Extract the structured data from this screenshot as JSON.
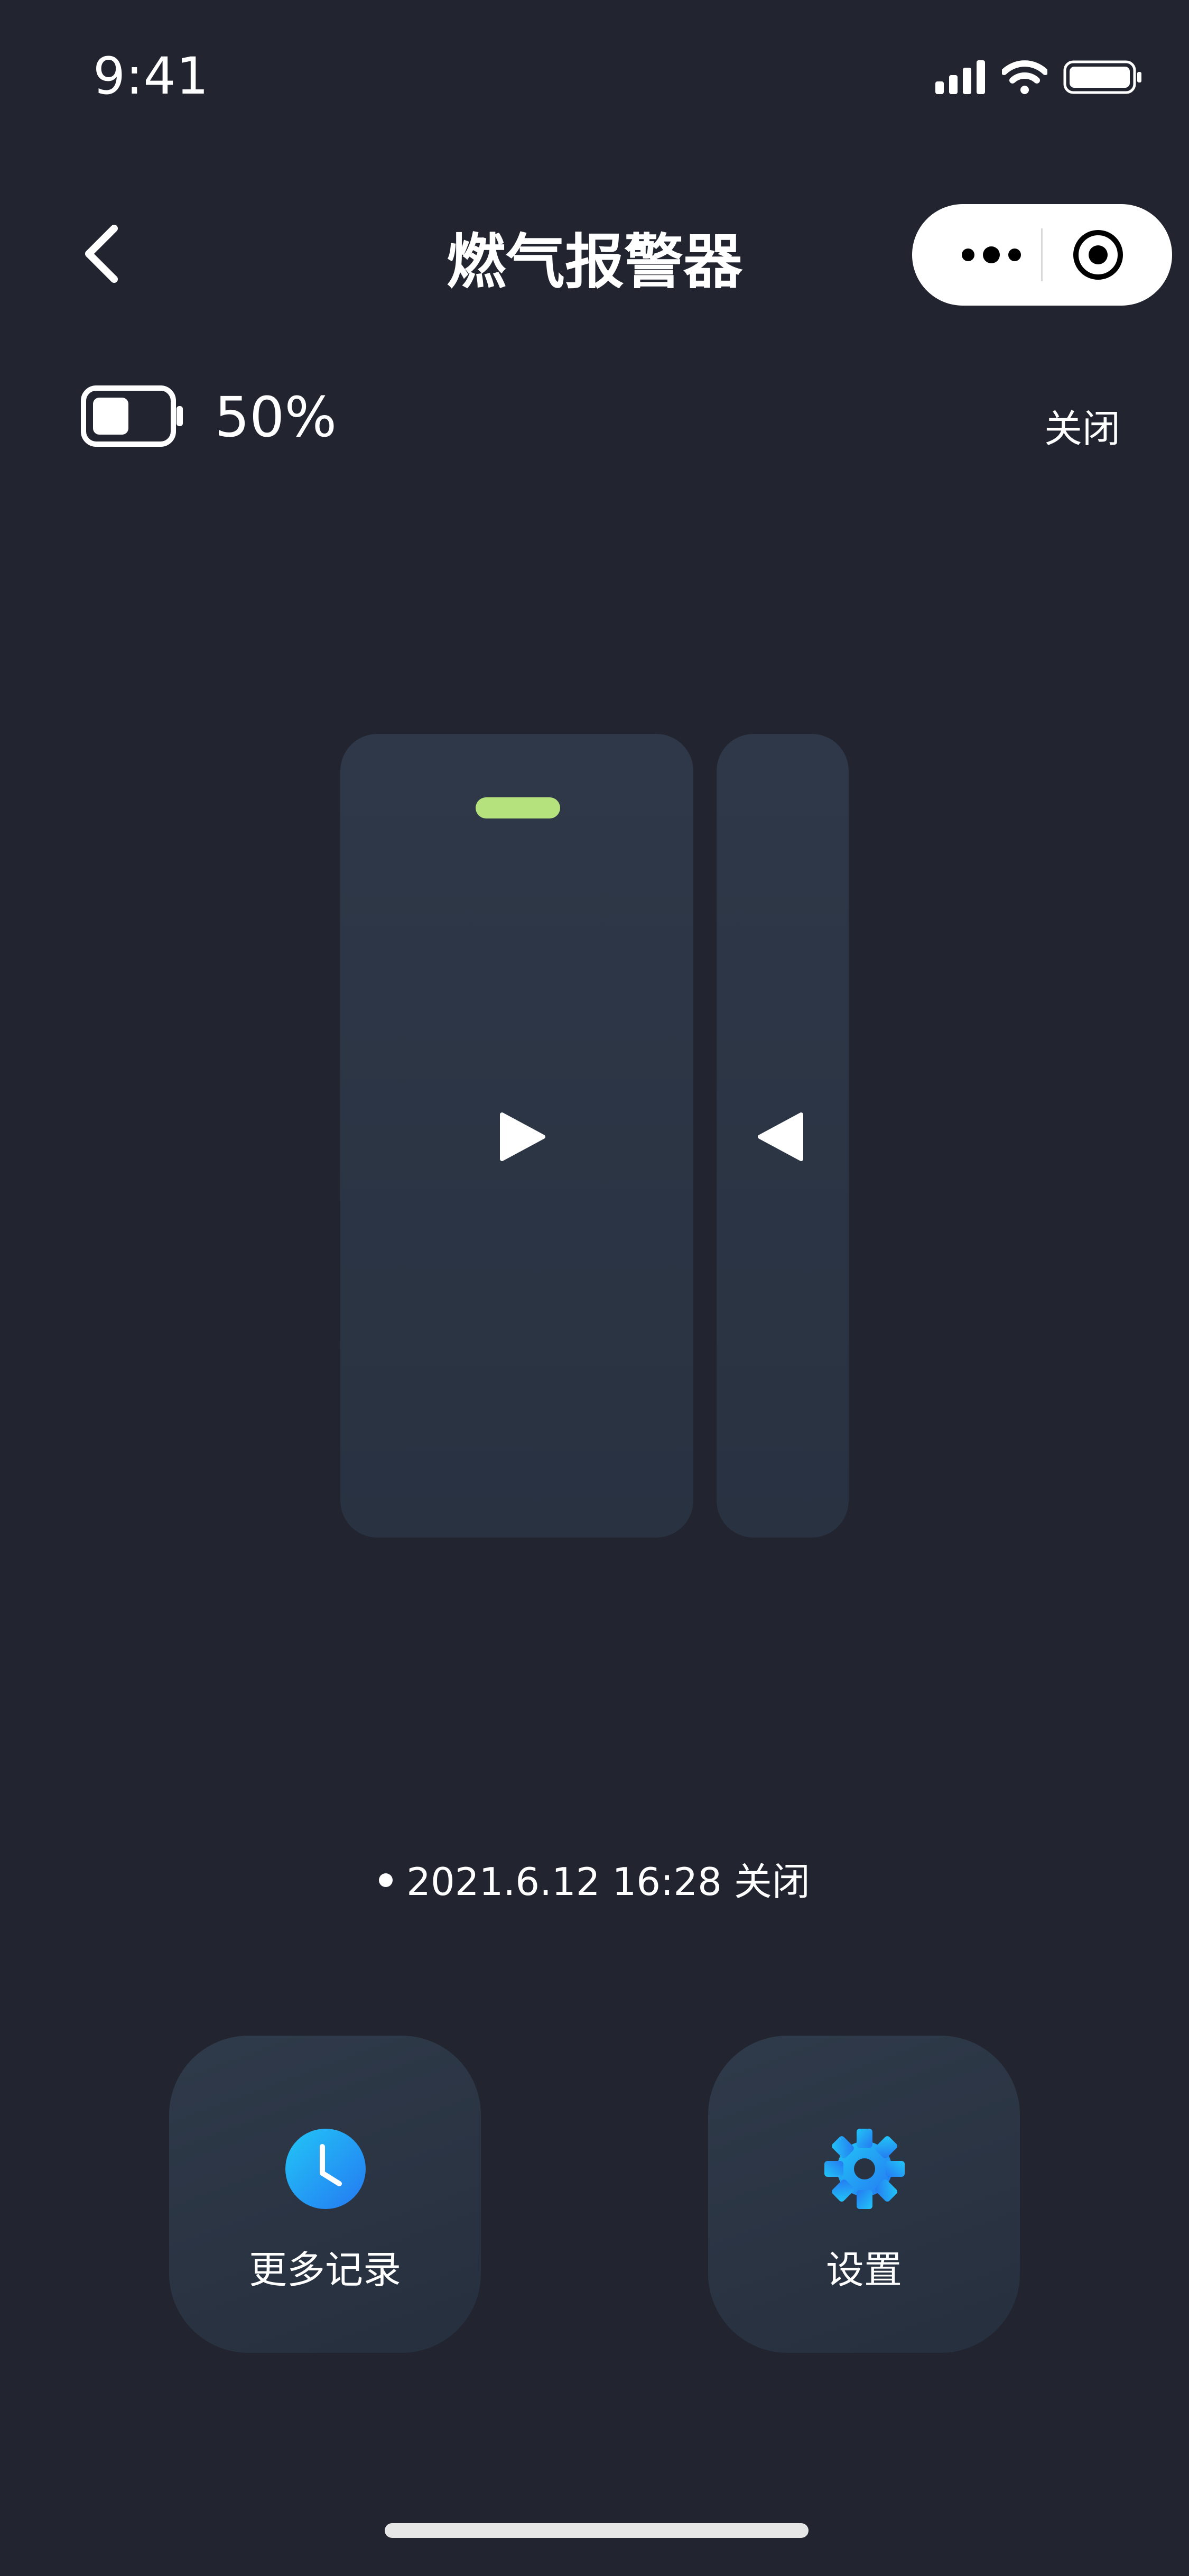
{
  "status_bar": {
    "time": "9:41",
    "icons": [
      "signal-icon",
      "wifi-icon",
      "battery-status-icon"
    ]
  },
  "nav": {
    "title": "燃气报警器",
    "back_icon": "chevron-left-icon",
    "capsule_icons": [
      "more-dots-icon",
      "target-icon"
    ]
  },
  "device": {
    "battery_percent_label": "50%",
    "battery_level": 0.5,
    "state_label": "关闭",
    "led_color": "#b6e27e"
  },
  "last_record": {
    "text": "2021.6.12 16:28 关闭"
  },
  "actions": [
    {
      "label": "更多记录",
      "icon": "clock-icon"
    },
    {
      "label": "设置",
      "icon": "gear-icon"
    }
  ],
  "colors": {
    "background": "#22242f",
    "panel": "#2b3443",
    "accent_blue": "#1aa7f0"
  }
}
